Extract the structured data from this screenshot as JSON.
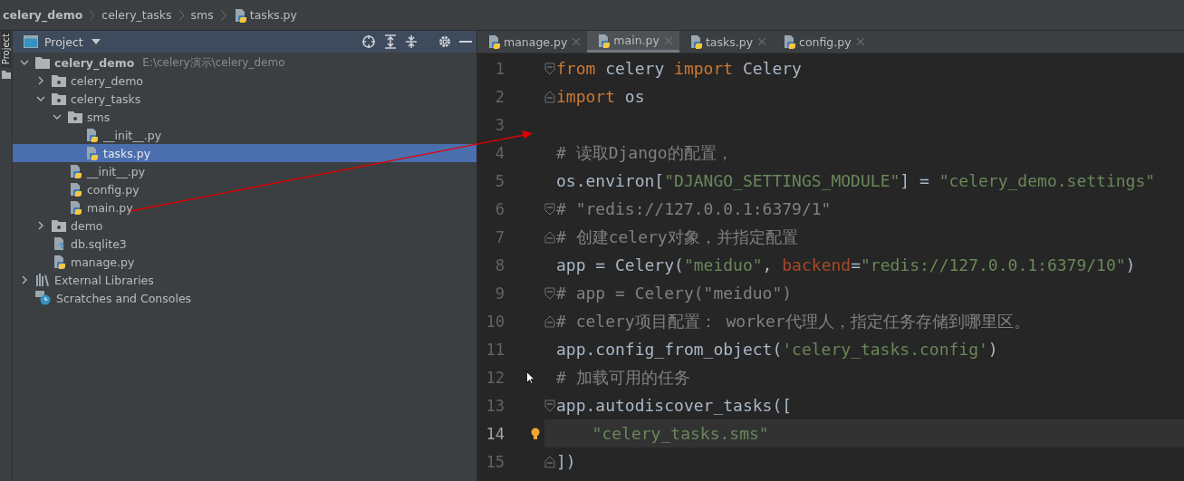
{
  "breadcrumb": [
    {
      "label": "celery_demo",
      "kind": "root"
    },
    {
      "label": "celery_tasks",
      "kind": "folder"
    },
    {
      "label": "sms",
      "kind": "folder"
    },
    {
      "label": "tasks.py",
      "kind": "python"
    }
  ],
  "side_stripe": {
    "label": "Project"
  },
  "project_panel": {
    "title": "Project"
  },
  "tree": [
    {
      "label": "celery_demo",
      "hint": "E:\\celery演示\\celery_demo",
      "kind": "project",
      "expanded": true,
      "selected": false,
      "children": [
        {
          "label": "celery_demo",
          "kind": "package",
          "expanded": false,
          "selected": false
        },
        {
          "label": "celery_tasks",
          "kind": "package",
          "expanded": true,
          "selected": false,
          "children": [
            {
              "label": "sms",
              "kind": "package",
              "expanded": true,
              "selected": false,
              "children": [
                {
                  "label": "__init__.py",
                  "kind": "python",
                  "selected": false
                },
                {
                  "label": "tasks.py",
                  "kind": "python",
                  "selected": true
                }
              ]
            },
            {
              "label": "__init__.py",
              "kind": "python",
              "selected": false
            },
            {
              "label": "config.py",
              "kind": "python",
              "selected": false
            },
            {
              "label": "main.py",
              "kind": "python",
              "selected": false
            }
          ]
        },
        {
          "label": "demo",
          "kind": "package",
          "expanded": false,
          "selected": false
        },
        {
          "label": "db.sqlite3",
          "kind": "unknown",
          "selected": false
        },
        {
          "label": "manage.py",
          "kind": "python",
          "selected": false
        }
      ]
    },
    {
      "label": "External Libraries",
      "kind": "library",
      "expanded": false,
      "selected": false
    },
    {
      "label": "Scratches and Consoles",
      "kind": "scratch",
      "selected": false
    }
  ],
  "tabs": [
    {
      "label": "manage.py",
      "selected": false
    },
    {
      "label": "main.py",
      "selected": true
    },
    {
      "label": "tasks.py",
      "selected": false
    },
    {
      "label": "config.py",
      "selected": false
    }
  ],
  "code_lines": [
    {
      "number": "1",
      "fold_start": true,
      "current": false,
      "tokens": [
        {
          "kind": "kw",
          "text": "from"
        },
        {
          "kind": "plain",
          "text": " celery "
        },
        {
          "kind": "kw",
          "text": "import"
        },
        {
          "kind": "plain",
          "text": " Celery"
        }
      ]
    },
    {
      "number": "2",
      "fold_end": true,
      "current": false,
      "tokens": [
        {
          "kind": "kw",
          "text": "import"
        },
        {
          "kind": "plain",
          "text": " os"
        }
      ]
    },
    {
      "number": "3",
      "current": false
    },
    {
      "number": "4",
      "current": false,
      "tokens": [
        {
          "kind": "cmt",
          "text": "# 读取Django的配置，"
        }
      ]
    },
    {
      "number": "5",
      "current": false,
      "tokens": [
        {
          "kind": "plain",
          "text": "os.environ["
        },
        {
          "kind": "str",
          "text": "\"DJANGO_SETTINGS_MODULE\""
        },
        {
          "kind": "plain",
          "text": "] = "
        },
        {
          "kind": "str",
          "text": "\"celery_demo.settings\""
        }
      ]
    },
    {
      "number": "6",
      "fold_start": true,
      "current": false,
      "tokens": [
        {
          "kind": "cmt",
          "text": "# \"redis://127.0.0.1:6379/1\""
        }
      ]
    },
    {
      "number": "7",
      "fold_end": true,
      "current": false,
      "tokens": [
        {
          "kind": "cmt",
          "text": "# 创建celery对象，并指定配置"
        }
      ]
    },
    {
      "number": "8",
      "current": false,
      "tokens": [
        {
          "kind": "plain",
          "text": "app = Celery("
        },
        {
          "kind": "str",
          "text": "\"meiduo\""
        },
        {
          "kind": "plain",
          "text": ", "
        },
        {
          "kind": "param",
          "text": "backend"
        },
        {
          "kind": "plain",
          "text": "="
        },
        {
          "kind": "str",
          "text": "\"redis://127.0.0.1:6379/10\""
        },
        {
          "kind": "plain",
          "text": ")"
        }
      ]
    },
    {
      "number": "9",
      "fold_start": true,
      "current": false,
      "tokens": [
        {
          "kind": "cmt",
          "text": "# app = Celery(\"meiduo\")"
        }
      ]
    },
    {
      "number": "10",
      "fold_end": true,
      "current": false,
      "tokens": [
        {
          "kind": "cmt",
          "text": "# celery项目配置： worker代理人，指定任务存储到哪里区。"
        }
      ]
    },
    {
      "number": "11",
      "current": false,
      "tokens": [
        {
          "kind": "plain",
          "text": "app.config_from_object("
        },
        {
          "kind": "str",
          "text": "'celery_tasks.config'"
        },
        {
          "kind": "plain",
          "text": ")"
        }
      ]
    },
    {
      "number": "12",
      "current": false,
      "tokens": [
        {
          "kind": "cmt",
          "text": "# 加载可用的任务"
        }
      ]
    },
    {
      "number": "13",
      "fold_start": true,
      "current": false,
      "tokens": [
        {
          "kind": "plain",
          "text": "app.autodiscover_tasks(["
        }
      ]
    },
    {
      "number": "14",
      "current": true,
      "bulb": true,
      "indented": true,
      "tokens": [
        {
          "kind": "str",
          "text": "\"celery_tasks.sms\""
        }
      ]
    },
    {
      "number": "15",
      "fold_end": true,
      "current": false,
      "tokens": [
        {
          "kind": "plain",
          "text": "])"
        }
      ]
    }
  ]
}
